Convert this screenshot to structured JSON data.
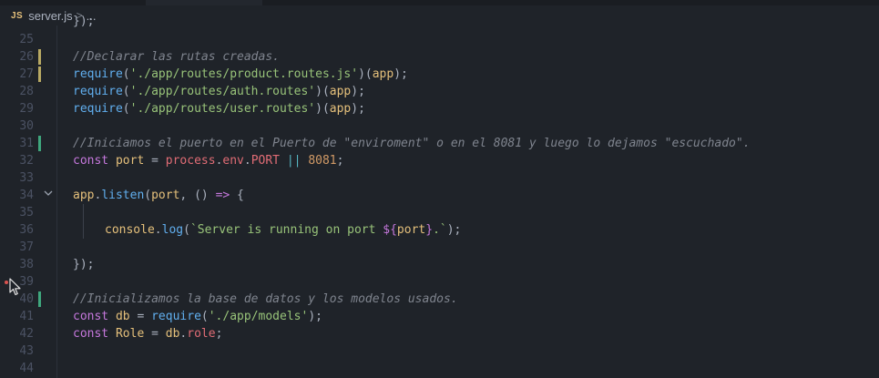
{
  "breadcrumb": {
    "file_icon": "JS",
    "file_name": "server.js",
    "separator": ">",
    "more": "..."
  },
  "gutter": {
    "top_partial_line": "});"
  },
  "lines": [
    {
      "n": "25",
      "text": ""
    },
    {
      "n": "26",
      "text": "//Declarar las rutas creadas."
    },
    {
      "n": "27",
      "text": "require('./app/routes/product.routes.js')(app);"
    },
    {
      "n": "28",
      "text": "require('./app/routes/auth.routes')(app);"
    },
    {
      "n": "29",
      "text": "require('./app/routes/user.routes')(app);"
    },
    {
      "n": "30",
      "text": ""
    },
    {
      "n": "31",
      "text": "//Iniciamos el puerto en el Puerto de \"enviroment\" o en el 8081 y luego lo dejamos \"escuchado\"."
    },
    {
      "n": "32",
      "text": "const port = process.env.PORT || 8081;"
    },
    {
      "n": "33",
      "text": ""
    },
    {
      "n": "34",
      "text": "app.listen(port, () => {"
    },
    {
      "n": "35",
      "text": ""
    },
    {
      "n": "36",
      "text": "console.log(`Server is running on port ${port}.`);"
    },
    {
      "n": "37",
      "text": ""
    },
    {
      "n": "38",
      "text": "});"
    },
    {
      "n": "39",
      "text": ""
    },
    {
      "n": "40",
      "text": "//Inicializamos la base de datos y los modelos usados."
    },
    {
      "n": "41",
      "text": "const db = require('./app/models');"
    },
    {
      "n": "42",
      "text": "const Role = db.role;"
    },
    {
      "n": "43",
      "text": ""
    },
    {
      "n": "44",
      "text": ""
    }
  ],
  "tokens": {
    "l26": [
      "//Declarar las rutas creadas."
    ],
    "l27": [
      "require",
      "(",
      "'./app/routes/product.routes.js'",
      ")(",
      "app",
      ");"
    ],
    "l28": [
      "require",
      "(",
      "'./app/routes/auth.routes'",
      ")(",
      "app",
      ");"
    ],
    "l29": [
      "require",
      "(",
      "'./app/routes/user.routes'",
      ")(",
      "app",
      ");"
    ],
    "l31": [
      "//Iniciamos el puerto en el Puerto de \"enviroment\" o en el 8081 y luego lo dejamos \"escuchado\"."
    ],
    "l32": [
      "const",
      " ",
      "port",
      " = ",
      "process",
      ".",
      "env",
      ".",
      "PORT",
      " ",
      "||",
      " ",
      "8081",
      ";"
    ],
    "l34": [
      "app",
      ".",
      "listen",
      "(",
      "port",
      ", () ",
      "=>",
      " {"
    ],
    "l36": [
      "console",
      ".",
      "log",
      "(",
      "`Server is running on port ",
      "${",
      "port",
      "}",
      ".`",
      ");"
    ],
    "l38": [
      "});"
    ],
    "l40": [
      "//Inicializamos la base de datos y los modelos usados."
    ],
    "l41": [
      "const",
      " ",
      "db",
      " = ",
      "require",
      "(",
      "'./app/models'",
      ");"
    ],
    "l42": [
      "const",
      " ",
      "Role",
      " = ",
      "db",
      ".",
      "role",
      ";"
    ]
  },
  "colors": {
    "background": "#1f2329",
    "comment": "#7f848e",
    "function": "#61afef",
    "string": "#98c379",
    "variable": "#e5c07b",
    "keyword": "#c678dd",
    "property": "#e06c75",
    "number": "#d19a66",
    "operator": "#56b6c2",
    "gutter_modified": "#b8a963",
    "gutter_added": "#3fa77d"
  },
  "icons": {
    "fold": "chevron-down-icon",
    "cursor": "mouse-pointer-icon"
  }
}
